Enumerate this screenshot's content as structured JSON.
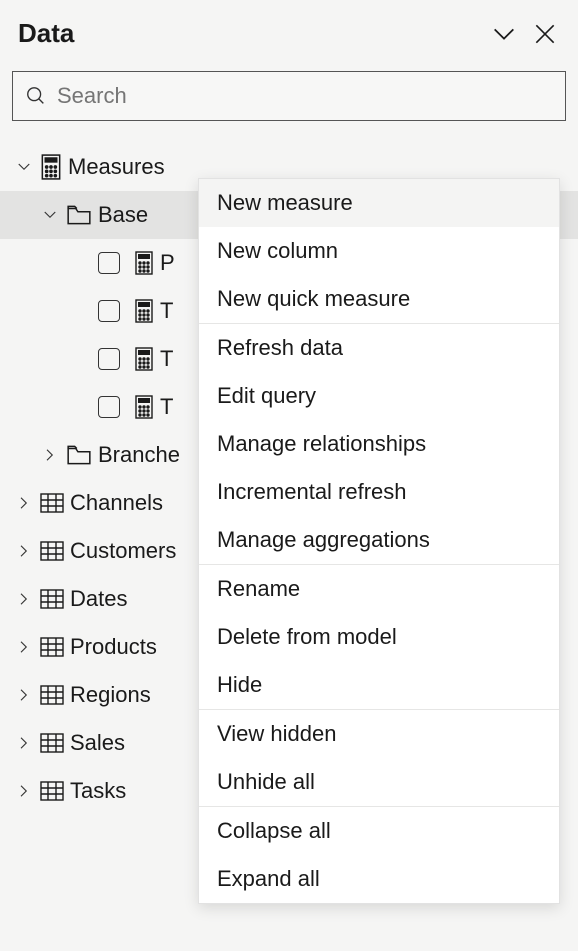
{
  "header": {
    "title": "Data"
  },
  "search": {
    "placeholder": "Search"
  },
  "tree": {
    "measures_label": "Measures",
    "base_label": "Base",
    "base_children": {
      "0": "P",
      "1": "T",
      "2": "T",
      "3": "T"
    },
    "branches_label": "Branche",
    "tables": {
      "0": "Channels",
      "1": "Customers",
      "2": "Dates",
      "3": "Products",
      "4": "Regions",
      "5": "Sales",
      "6": "Tasks"
    }
  },
  "menu": {
    "0": "New measure",
    "1": "New column",
    "2": "New quick measure",
    "3": "Refresh data",
    "4": "Edit query",
    "5": "Manage relationships",
    "6": "Incremental refresh",
    "7": "Manage aggregations",
    "8": "Rename",
    "9": "Delete from model",
    "10": "Hide",
    "11": "View hidden",
    "12": "Unhide all",
    "13": "Collapse all",
    "14": "Expand all"
  }
}
